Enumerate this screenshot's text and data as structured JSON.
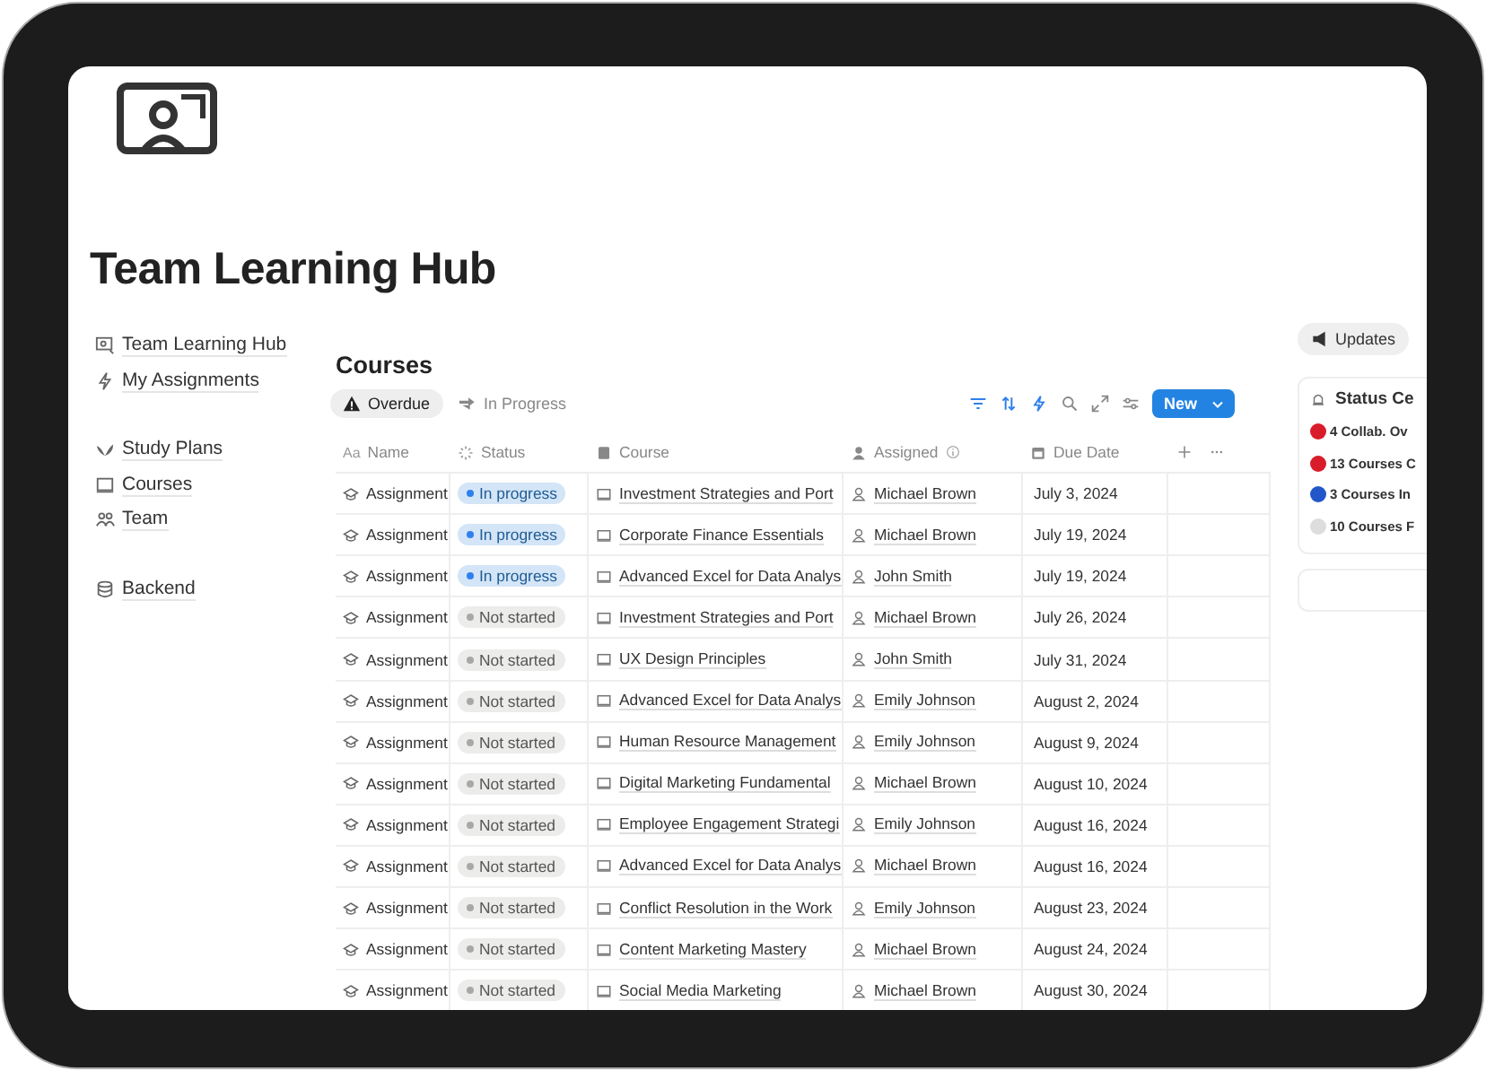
{
  "page": {
    "title": "Team Learning Hub"
  },
  "sidebar": {
    "groups": [
      [
        {
          "label": "Team Learning Hub",
          "kind": "hub"
        },
        {
          "label": "My Assignments",
          "kind": "bolt"
        }
      ],
      [
        {
          "label": "Study Plans",
          "kind": "plant"
        },
        {
          "label": "Courses",
          "kind": "laptop"
        },
        {
          "label": "Team",
          "kind": "people"
        }
      ],
      [
        {
          "label": "Backend",
          "kind": "database"
        }
      ]
    ]
  },
  "database": {
    "title": "Courses",
    "views": [
      {
        "label": "Overdue",
        "kind": "warning",
        "selected": true
      },
      {
        "label": "In Progress",
        "kind": "arrows",
        "selected": false
      }
    ],
    "new_button": "New",
    "columns": [
      {
        "label": "Name",
        "kind": "text",
        "icon_text": "Aa"
      },
      {
        "label": "Status",
        "kind": "status"
      },
      {
        "label": "Course",
        "kind": "book"
      },
      {
        "label": "Assigned",
        "kind": "person",
        "info": true
      },
      {
        "label": "Due Date",
        "kind": "calendar"
      }
    ],
    "rows": [
      {
        "name": "Assignment",
        "status": "In progress",
        "kind": "progress",
        "course": "Investment Strategies and Port",
        "assigned": "Michael Brown",
        "due": "July 3, 2024"
      },
      {
        "name": "Assignment",
        "status": "In progress",
        "kind": "progress",
        "course": "Corporate Finance Essentials",
        "assigned": "Michael Brown",
        "due": "July 19, 2024"
      },
      {
        "name": "Assignment",
        "status": "In progress",
        "kind": "progress",
        "course": "Advanced Excel for Data Analys",
        "assigned": "John Smith",
        "due": "July 19, 2024"
      },
      {
        "name": "Assignment",
        "status": "Not started",
        "kind": "todo",
        "course": "Investment Strategies and Port",
        "assigned": "Michael Brown",
        "due": "July 26, 2024"
      },
      {
        "name": "Assignment",
        "status": "Not started",
        "kind": "todo",
        "course": "UX Design Principles",
        "assigned": "John Smith",
        "due": "July 31, 2024"
      },
      {
        "name": "Assignment",
        "status": "Not started",
        "kind": "todo",
        "course": "Advanced Excel for Data Analys",
        "assigned": "Emily Johnson",
        "due": "August 2, 2024"
      },
      {
        "name": "Assignment",
        "status": "Not started",
        "kind": "todo",
        "course": "Human Resource Management",
        "assigned": "Emily Johnson",
        "due": "August 9, 2024"
      },
      {
        "name": "Assignment",
        "status": "Not started",
        "kind": "todo",
        "course": "Digital Marketing Fundamental",
        "assigned": "Michael Brown",
        "due": "August 10, 2024"
      },
      {
        "name": "Assignment",
        "status": "Not started",
        "kind": "todo",
        "course": "Employee Engagement Strategi",
        "assigned": "Emily Johnson",
        "due": "August 16, 2024"
      },
      {
        "name": "Assignment",
        "status": "Not started",
        "kind": "todo",
        "course": "Advanced Excel for Data Analys",
        "assigned": "Michael Brown",
        "due": "August 16, 2024"
      },
      {
        "name": "Assignment",
        "status": "Not started",
        "kind": "todo",
        "course": "Conflict Resolution in the Work",
        "assigned": "Emily Johnson",
        "due": "August 23, 2024"
      },
      {
        "name": "Assignment",
        "status": "Not started",
        "kind": "todo",
        "course": "Content Marketing Mastery",
        "assigned": "Michael Brown",
        "due": "August 24, 2024"
      },
      {
        "name": "Assignment",
        "status": "Not started",
        "kind": "todo",
        "course": "Social Media Marketing",
        "assigned": "Michael Brown",
        "due": "August 30, 2024"
      }
    ]
  },
  "updates": {
    "button": "Updates",
    "panel_title": "Status Ce",
    "items": [
      {
        "text": "4 Collab. Ov",
        "color": "#d91c2a"
      },
      {
        "text": "13 Courses C",
        "color": "#d91c2a"
      },
      {
        "text": "3 Courses In",
        "color": "#2257c9"
      },
      {
        "text": "10 Courses F",
        "color": "#dddddd"
      }
    ]
  }
}
